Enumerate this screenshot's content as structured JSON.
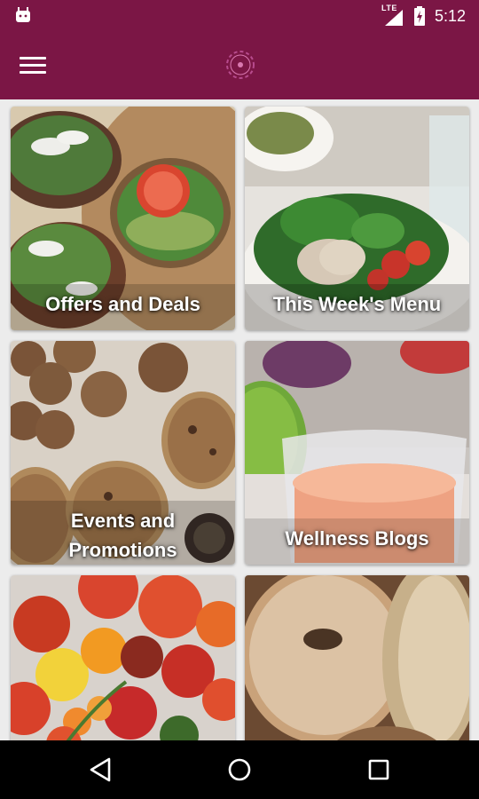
{
  "status_bar": {
    "network": "LTE",
    "time": "5:12",
    "icons": [
      "android-icon",
      "signal-icon",
      "battery-charging-icon"
    ]
  },
  "app_bar": {
    "icons": [
      "menu-icon",
      "logo-icon"
    ]
  },
  "tiles": [
    {
      "label": "Offers and Deals",
      "image": "open-faced sandwiches photo"
    },
    {
      "label": "This Week's Menu",
      "image": "salad bowl photo"
    },
    {
      "label_line1": "Events and",
      "label_line2": "Promotions",
      "image": "cookies photo"
    },
    {
      "label": "Wellness Blogs",
      "image": "smoothie glass photo"
    },
    {
      "label": "",
      "image": "tomatoes photo"
    },
    {
      "label": "",
      "image": "bagels photo"
    }
  ],
  "colors": {
    "primary": "#7b1645",
    "background": "#ececec",
    "nav_bar": "#000000"
  },
  "nav_bar": {
    "icons": [
      "back-icon",
      "home-icon",
      "recents-icon"
    ]
  }
}
